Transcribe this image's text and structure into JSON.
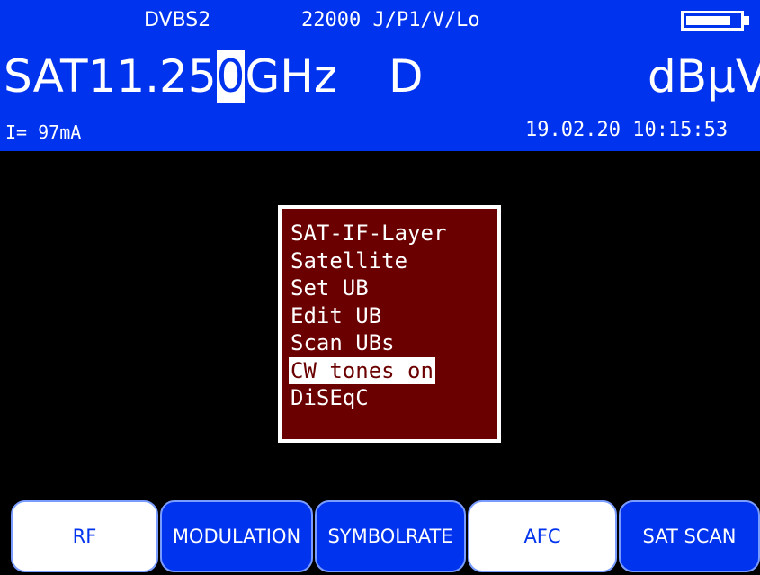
{
  "header": {
    "mode": "DVBS2",
    "params": "22000 J/P1/V/Lo",
    "battery_level": 0.85,
    "band": "SAT",
    "freq_before_cursor": "11.25",
    "freq_cursor_digit": "0",
    "freq_unit": "GHz",
    "polarity": "D",
    "level_unit": "dBμV",
    "current": "I= 97mA",
    "datetime": "19.02.20 10:15:53"
  },
  "menu": {
    "items": [
      {
        "label": "SAT-IF-Layer"
      },
      {
        "label": "Satellite"
      },
      {
        "label": "Set UB"
      },
      {
        "label": "Edit UB"
      },
      {
        "label": "Scan UBs"
      },
      {
        "label": "CW tones on",
        "selected": true
      },
      {
        "label": "DiSEqC"
      }
    ]
  },
  "softkeys": [
    {
      "label": "RF"
    },
    {
      "label": "MODULATION"
    },
    {
      "label": "SYMBOLRATE"
    },
    {
      "label": "AFC"
    },
    {
      "label": "SAT SCAN"
    }
  ],
  "colors": {
    "header_bg": "#0033ee",
    "menu_bg": "#6b0000",
    "screen_bg": "#000000"
  }
}
